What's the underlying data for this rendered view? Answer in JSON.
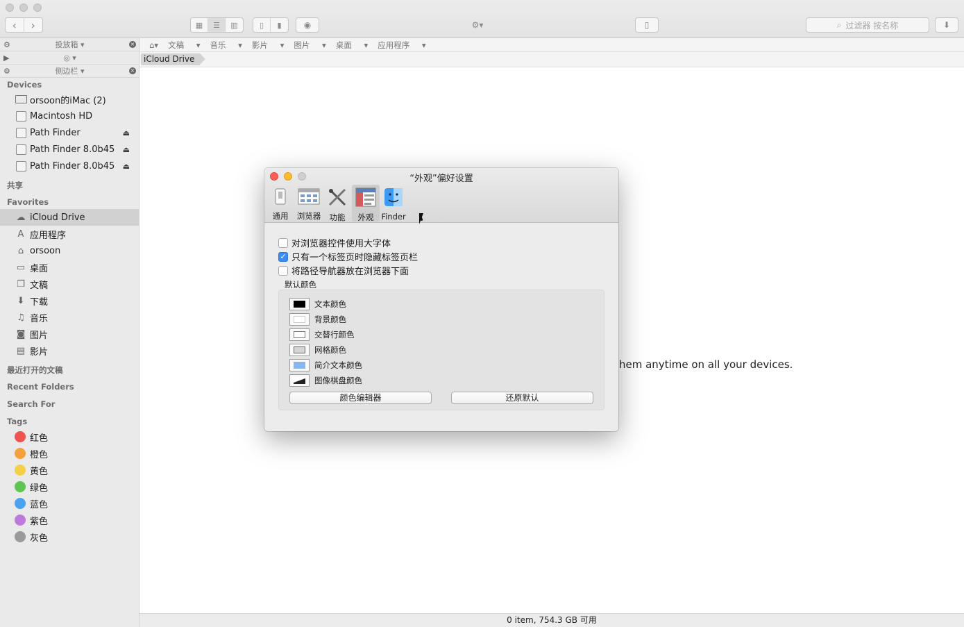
{
  "toolbar": {
    "nav_back": "‹",
    "nav_forward": "›",
    "search_placeholder": "过滤器 按名称"
  },
  "sidebar": {
    "shelf_strip": "投放箱",
    "sidebar_strip": "侧边栏",
    "devices_header": "Devices",
    "devices": [
      {
        "label": "orsoon的iMac (2)",
        "icon": "imac-icon"
      },
      {
        "label": "Macintosh HD",
        "icon": "hard-drive-icon"
      },
      {
        "label": "Path Finder",
        "icon": "disk-image-icon",
        "eject": true
      },
      {
        "label": "Path Finder 8.0b45",
        "icon": "disk-image-icon",
        "eject": true
      },
      {
        "label": "Path Finder 8.0b45",
        "icon": "disk-image-icon",
        "eject": true
      }
    ],
    "shared_header": "共享",
    "favorites_header": "Favorites",
    "favorites": [
      {
        "label": "iCloud Drive",
        "icon": "cloud-icon",
        "selected": true
      },
      {
        "label": "应用程序",
        "icon": "applications-icon"
      },
      {
        "label": "orsoon",
        "icon": "home-icon"
      },
      {
        "label": "桌面",
        "icon": "desktop-icon"
      },
      {
        "label": "文稿",
        "icon": "documents-icon"
      },
      {
        "label": "下载",
        "icon": "download-icon"
      },
      {
        "label": "音乐",
        "icon": "music-icon"
      },
      {
        "label": "图片",
        "icon": "camera-icon"
      },
      {
        "label": "影片",
        "icon": "film-icon"
      }
    ],
    "recent_docs_header": "最近打开的文稿",
    "recent_folders_header": "Recent Folders",
    "search_for_header": "Search For",
    "tags_header": "Tags",
    "tags": [
      {
        "label": "红色",
        "color": "#f0544f"
      },
      {
        "label": "橙色",
        "color": "#f5a03b"
      },
      {
        "label": "黄色",
        "color": "#f4cf48"
      },
      {
        "label": "绿色",
        "color": "#5ec552"
      },
      {
        "label": "蓝色",
        "color": "#4aa3f0"
      },
      {
        "label": "紫色",
        "color": "#bd79db"
      },
      {
        "label": "灰色",
        "color": "#9a9a9a"
      }
    ]
  },
  "pathbar": {
    "items": [
      "文稿",
      "音乐",
      "影片",
      "图片",
      "桌面",
      "应用程序"
    ]
  },
  "breadcrumb": {
    "current": "iCloud Drive"
  },
  "main": {
    "background_message": "hem anytime on all your devices."
  },
  "status": {
    "text": "0 item, 754.3 GB 可用"
  },
  "dialog": {
    "title": "“外观”偏好设置",
    "tabs": [
      {
        "label": "通用",
        "icon": "general-icon"
      },
      {
        "label": "浏览器",
        "icon": "browser-icon"
      },
      {
        "label": "功能",
        "icon": "features-icon"
      },
      {
        "label": "外观",
        "icon": "appearance-icon",
        "selected": true
      },
      {
        "label": "Finder",
        "icon": "finder-icon"
      }
    ],
    "checkboxes": [
      {
        "label": "对浏览器控件使用大字体",
        "checked": false
      },
      {
        "label": "只有一个标签页时隐藏标签页栏",
        "checked": true
      },
      {
        "label": "将路径导航器放在浏览器下面",
        "checked": false
      }
    ],
    "group_title": "默认颜色",
    "colors": [
      {
        "label": "文本颜色",
        "swatch": "#000000"
      },
      {
        "label": "背景颜色",
        "swatch": "#ffffff"
      },
      {
        "label": "交替行颜色",
        "swatch": "#ffffff"
      },
      {
        "label": "网格颜色",
        "swatch": "#d4d4d4"
      },
      {
        "label": "简介文本颜色",
        "swatch": "#86b7ef"
      },
      {
        "label": "图像棋盘颜色",
        "swatch": "diagonal"
      }
    ],
    "color_editor_button": "颜色编辑器",
    "restore_defaults_button": "还原默认"
  }
}
